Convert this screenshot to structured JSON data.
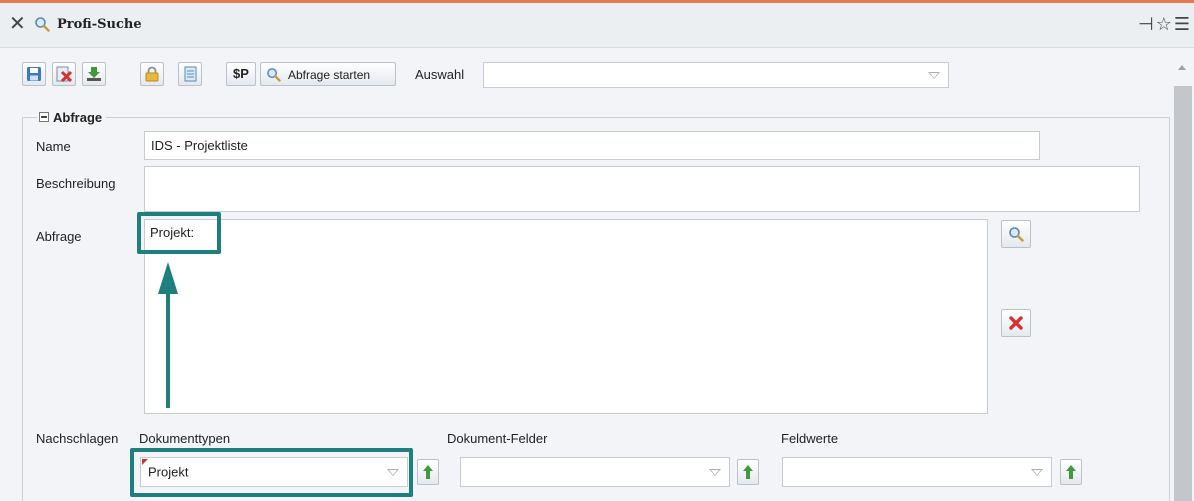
{
  "window": {
    "title": "Profi-Suche",
    "close_icon": "close-icon",
    "title_icon": "magnifier-icon",
    "right_icons": [
      "pin-icon",
      "star-icon",
      "menu-icon"
    ]
  },
  "toolbar": {
    "icons": [
      "save-icon",
      "delete-icon",
      "download-icon",
      "lock-icon",
      "notes-icon"
    ],
    "sp_label": "$P",
    "run_label": "Abfrage starten",
    "auswahl_label": "Auswahl",
    "auswahl_value": ""
  },
  "section": {
    "legend": "Abfrage",
    "name_label": "Name",
    "name_value": "IDS - Projektliste",
    "beschreibung_label": "Beschreibung",
    "beschreibung_value": "",
    "abfrage_label": "Abfrage",
    "abfrage_value": "Projekt:",
    "nachschlagen_label": "Nachschlagen",
    "dokumenttypen_label": "Dokumenttypen",
    "dokumenttypen_value": "Projekt",
    "dokument_felder_label": "Dokument-Felder",
    "dokument_felder_value": "",
    "feldwerte_label": "Feldwerte",
    "feldwerte_value": ""
  },
  "colors": {
    "accent_line": "#e07a53",
    "highlight": "#1f7f7c",
    "panel_bg": "#f2f4f7"
  }
}
